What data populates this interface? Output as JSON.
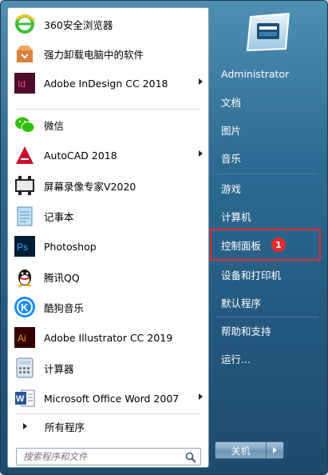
{
  "programs": [
    {
      "label": "360安全浏览器",
      "icon": "360-browser-icon",
      "arrow": false
    },
    {
      "label": "强力卸载电脑中的软件",
      "icon": "uninstall-box-icon",
      "arrow": false
    },
    {
      "label": "Adobe InDesign CC 2018",
      "icon": "indesign-icon",
      "arrow": true
    },
    {
      "label": "微信",
      "icon": "wechat-icon",
      "arrow": false
    },
    {
      "label": "AutoCAD 2018",
      "icon": "autocad-icon",
      "arrow": true
    },
    {
      "label": "屏幕录像专家V2020",
      "icon": "screen-recorder-icon",
      "arrow": false
    },
    {
      "label": "记事本",
      "icon": "notepad-icon",
      "arrow": false
    },
    {
      "label": "Photoshop",
      "icon": "photoshop-icon",
      "arrow": false
    },
    {
      "label": "腾讯QQ",
      "icon": "qq-icon",
      "arrow": false
    },
    {
      "label": "酷狗音乐",
      "icon": "kugou-icon",
      "arrow": false
    },
    {
      "label": "Adobe Illustrator CC 2019",
      "icon": "illustrator-icon",
      "arrow": false
    },
    {
      "label": "计算器",
      "icon": "calculator-icon",
      "arrow": false
    },
    {
      "label": "Microsoft Office Word 2007",
      "icon": "word-icon",
      "arrow": true
    }
  ],
  "all_programs": "所有程序",
  "search": {
    "placeholder": "搜索程序和文件"
  },
  "right": {
    "user": "Administrator",
    "documents": "文档",
    "pictures": "图片",
    "music": "音乐",
    "games": "游戏",
    "computer": "计算机",
    "control_panel": "控制面板",
    "devices_printers": "设备和打印机",
    "default_programs": "默认程序",
    "help_support": "帮助和支持",
    "run": "运行..."
  },
  "annotation_badge": "1",
  "shutdown": {
    "label": "关机"
  },
  "colors": {
    "highlight": "#e52b2b",
    "menu_blue": "#2d6a91"
  }
}
